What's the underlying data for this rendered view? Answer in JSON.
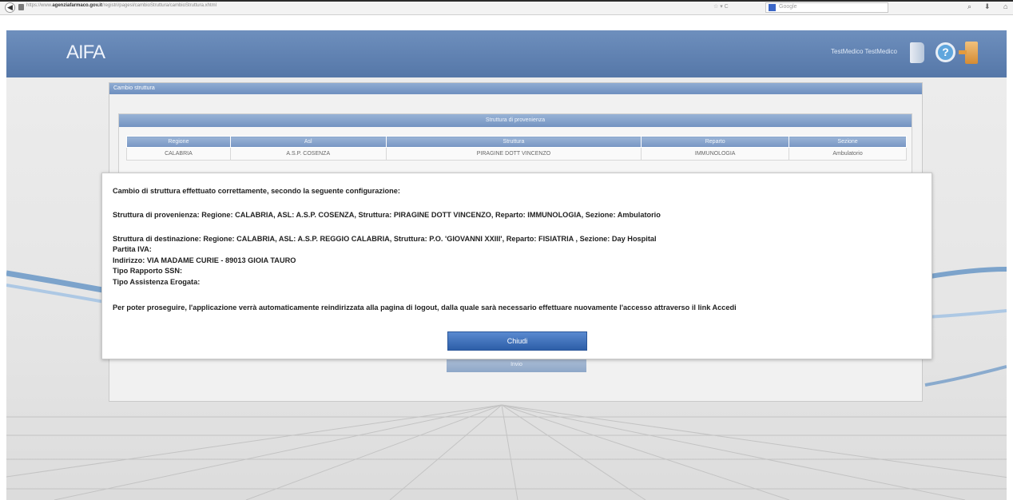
{
  "browser": {
    "url_prefix": "https://www.",
    "url_domain": "agenziafarmaco.gov.it",
    "url_path": "/registri/pagesl/cambioStruttura/cambioStruttura.xhtml",
    "search_placeholder": "Google",
    "url_tools": "☆ ▾ C"
  },
  "header": {
    "logo": "AIFA",
    "user_name": "TestMedico TestMedico"
  },
  "panel": {
    "title": "Cambio struttura",
    "section_title": "Struttura di provenienza",
    "columns": [
      "Regione",
      "Asl",
      "Struttura",
      "Reparto",
      "Sezione"
    ],
    "rows": [
      [
        "CALABRIA",
        "A.S.P. COSENZA",
        "PIRAGINE DOTT VINCENZO",
        "IMMUNOLOGIA",
        "Ambulatorio"
      ]
    ],
    "button_label": "Invio"
  },
  "modal": {
    "line1": "Cambio di struttura effettuato correttamente, secondo la seguente configurazione:",
    "line2": "Struttura di provenienza: Regione: CALABRIA, ASL: A.S.P. COSENZA, Struttura: PIRAGINE DOTT VINCENZO, Reparto: IMMUNOLOGIA, Sezione: Ambulatorio",
    "line3": "Struttura di destinazione: Regione: CALABRIA, ASL: A.S.P. REGGIO CALABRIA, Struttura: P.O. 'GIOVANNI XXIII', Reparto: FISIATRIA , Sezione: Day Hospital",
    "line4": "Partita IVA:",
    "line5": "Indirizzo: VIA MADAME CURIE - 89013 GIOIA TAURO",
    "line6": "Tipo Rapporto SSN:",
    "line7": "Tipo Assistenza Erogata:",
    "line8": "Per poter proseguire, l'applicazione verrà automaticamente reindirizzata alla pagina di logout, dalla quale sarà necessario effettuare nuovamente l'accesso attraverso il link Accedi",
    "close_label": "Chiudi"
  },
  "colors": {
    "header": "#5f80b2",
    "button": "#2d5ea8",
    "background": "#e8e8e8"
  }
}
